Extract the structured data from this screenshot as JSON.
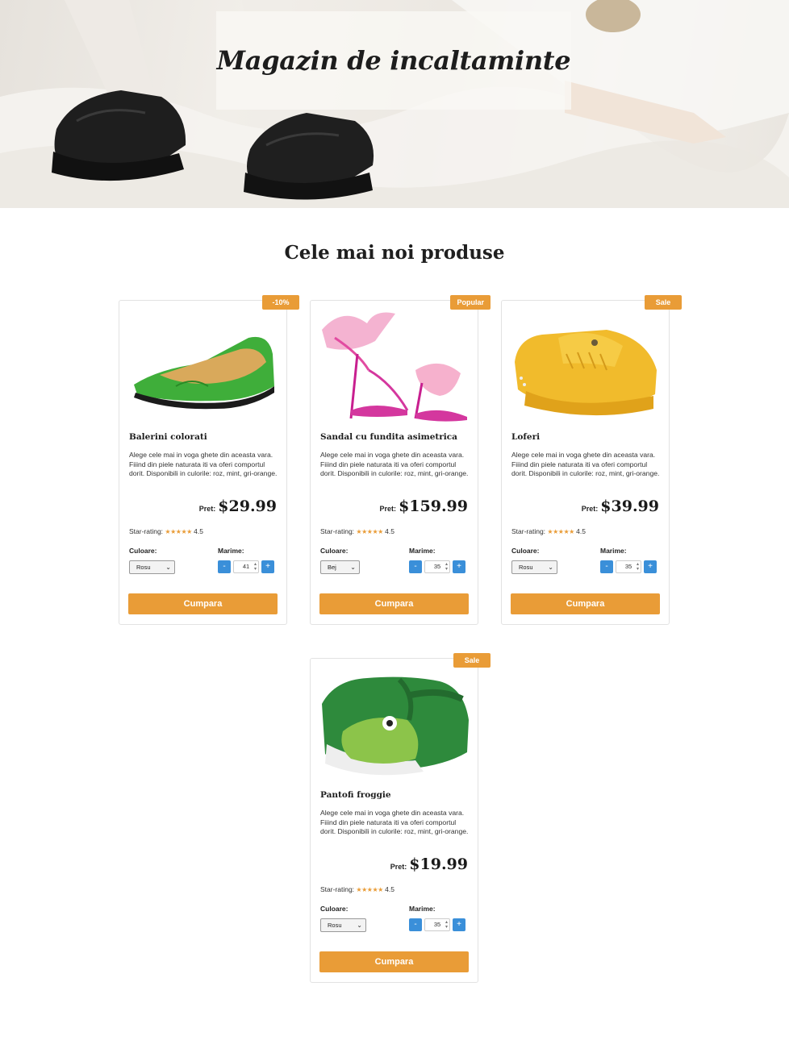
{
  "hero": {
    "title": "Magazin de incaltaminte"
  },
  "section": {
    "title": "Cele mai noi produse"
  },
  "labels": {
    "price": "Pret:",
    "rating": "Star-rating:",
    "color": "Culoare:",
    "size": "Marime:",
    "buy": "Cumpara",
    "minus": "-",
    "plus": "+",
    "stars": "★★★★★"
  },
  "products": [
    {
      "badge": "-10%",
      "name": "Balerini colorati",
      "description": "Alege cele mai in voga ghete din aceasta vara. Fiiind din piele naturata iti va oferi comportul dorit. Disponibili in culorile: roz, mint, gri-orange.",
      "price": "$29.99",
      "rating": "4.5",
      "color": "Rosu",
      "size": "41",
      "image_icon": "green-flat-shoe-image"
    },
    {
      "badge": "Popular",
      "name": "Sandal cu fundita asimetrica",
      "description": "Alege cele mai in voga ghete din aceasta vara. Fiiind din piele naturata iti va oferi comportul dorit. Disponibili in culorile: roz, mint, gri-orange.",
      "price": "$159.99",
      "rating": "4.5",
      "color": "Bej",
      "size": "35",
      "image_icon": "pink-bow-sandal-image"
    },
    {
      "badge": "Sale",
      "name": "Loferi",
      "description": "Alege cele mai in voga ghete din aceasta vara. Fiiind din piele naturata iti va oferi comportul dorit. Disponibili in culorile: roz, mint, gri-orange.",
      "price": "$39.99",
      "rating": "4.5",
      "color": "Rosu",
      "size": "35",
      "image_icon": "yellow-loafer-image"
    },
    {
      "badge": "Sale",
      "name": "Pantofi froggie",
      "description": "Alege cele mai in voga ghete din aceasta vara. Fiiind din piele naturata iti va oferi comportul dorit. Disponibili in culorile: roz, mint, gri-orange.",
      "price": "$19.99",
      "rating": "4.5",
      "color": "Rosu",
      "size": "35",
      "image_icon": "green-frog-shoe-image"
    }
  ],
  "colors": {
    "accent": "#e99c37",
    "stepper": "#3a8fd9"
  }
}
